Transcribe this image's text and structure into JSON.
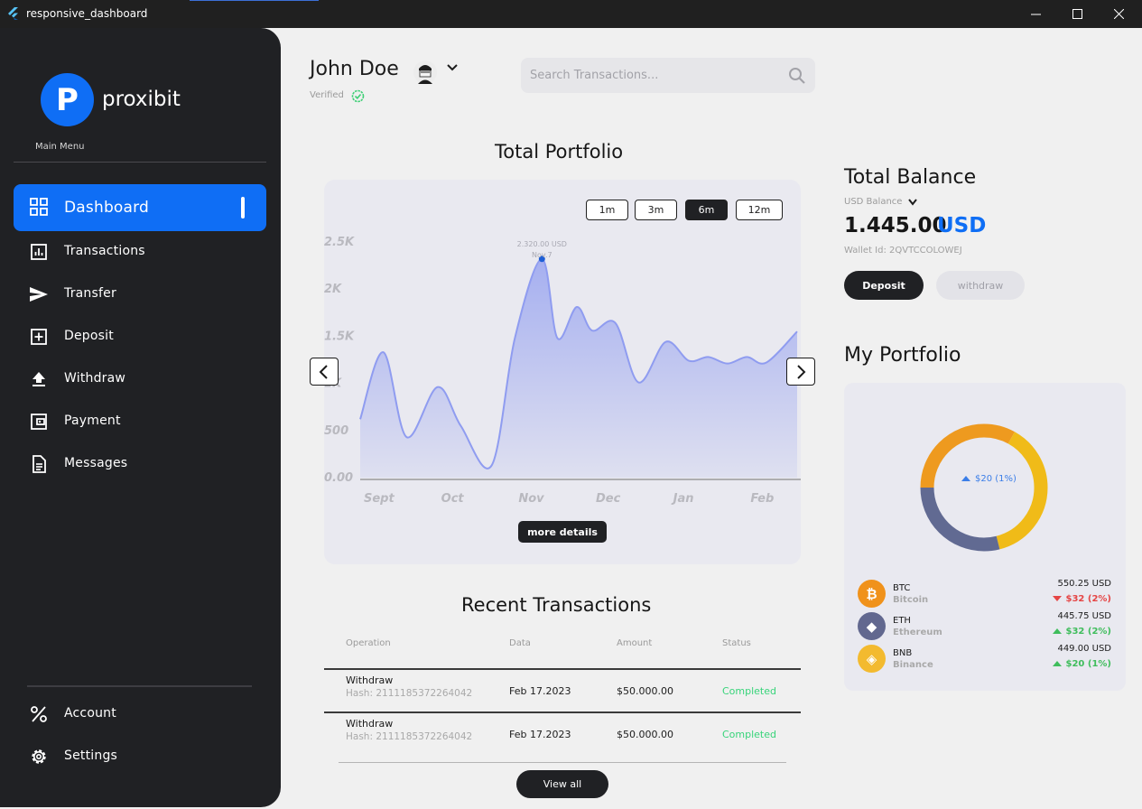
{
  "window": {
    "title": "responsive_dashboard"
  },
  "brand": {
    "letter": "P",
    "name": "proxibit",
    "accent": "#0f6ef5"
  },
  "sidebar": {
    "section_label": "Main Menu",
    "items": [
      {
        "label": "Dashboard",
        "icon": "grid-icon",
        "active": true
      },
      {
        "label": "Transactions",
        "icon": "bar-chart-icon"
      },
      {
        "label": "Transfer",
        "icon": "send-icon"
      },
      {
        "label": "Deposit",
        "icon": "plus-square-icon"
      },
      {
        "label": "Withdraw",
        "icon": "upload-icon"
      },
      {
        "label": "Payment",
        "icon": "wallet-icon"
      },
      {
        "label": "Messages",
        "icon": "document-icon"
      }
    ],
    "bottom_items": [
      {
        "label": "Account",
        "icon": "percent-icon"
      },
      {
        "label": "Settings",
        "icon": "gear-icon"
      }
    ]
  },
  "header": {
    "user_name": "John Doe",
    "verified_label": "Verified",
    "search_placeholder": "Search Transactions..."
  },
  "portfolio_chart": {
    "title": "Total Portfolio",
    "ranges": [
      "1m",
      "3m",
      "6m",
      "12m"
    ],
    "selected_range": "6m",
    "more_details_label": "more details",
    "tooltip_value": "2.320.00 USD",
    "tooltip_date": "Nov.7"
  },
  "chart_data": {
    "type": "area",
    "title": "Total Portfolio",
    "categories": [
      "Sept",
      "Oct",
      "Nov",
      "Dec",
      "Jan",
      "Feb"
    ],
    "y_tick_labels": [
      "0.00",
      "500",
      "1K",
      "1.5K",
      "2K",
      "2.5K"
    ],
    "ylim": [
      0,
      2500
    ],
    "x": [
      0,
      0.3,
      0.6,
      1.0,
      1.3,
      1.7,
      2.0,
      2.35,
      2.55,
      2.8,
      3.0,
      3.3,
      3.6,
      3.95,
      4.25,
      4.5,
      4.75,
      5.0,
      5.25,
      5.65
    ],
    "series": [
      {
        "values": [
          620,
          1330,
          430,
          960,
          550,
          130,
          1480,
          2320,
          1480,
          1810,
          1560,
          1640,
          1010,
          1440,
          1240,
          1280,
          1210,
          1280,
          1220,
          1550
        ]
      }
    ],
    "highlight_point": {
      "x": 2.35,
      "y": 2320,
      "label": "2.320.00 USD",
      "date": "Nov.7"
    },
    "grid": false,
    "color": "#8f9cf0"
  },
  "transactions": {
    "title": "Recent Transactions",
    "columns": [
      "Operation",
      "Data",
      "Amount",
      "Status"
    ],
    "rows": [
      {
        "operation": "Withdraw",
        "hash": "Hash: 2111185372264042",
        "date": "Feb 17.2023",
        "amount": "$50.000.00",
        "status": "Completed"
      },
      {
        "operation": "Withdraw",
        "hash": "Hash: 2111185372264042",
        "date": "Feb 17.2023",
        "amount": "$50.000.00",
        "status": "Completed"
      }
    ],
    "view_all_label": "View all"
  },
  "balance": {
    "title": "Total Balance",
    "selector_label": "USD Balance",
    "amount": "1.445.00",
    "currency": "USD",
    "wallet_id": "Wallet Id: 2QVTCCOLOWEJ",
    "deposit_label": "Deposit",
    "withdraw_label": "withdraw"
  },
  "my_portfolio": {
    "title": "My Portfolio",
    "center_label": "$20 (1%)",
    "donut_segments": [
      {
        "name": "BTC",
        "share": 0.33,
        "color": "#ee9a1f"
      },
      {
        "name": "BNB",
        "share": 0.38,
        "color": "#f0bb18"
      },
      {
        "name": "ETH",
        "share": 0.29,
        "color": "#616a92"
      }
    ],
    "coins": [
      {
        "symbol": "BTC",
        "name": "Bitcoin",
        "value": "550.25 USD",
        "change": "$32 (2%)",
        "direction": "down",
        "color": "#f0921b",
        "icon": "bitcoin-icon",
        "glyph": "₿"
      },
      {
        "symbol": "ETH",
        "name": "Ethereum",
        "value": "445.75 USD",
        "change": "$32 (2%)",
        "direction": "up",
        "color": "#62688f",
        "icon": "ethereum-icon",
        "glyph": "◆"
      },
      {
        "symbol": "BNB",
        "name": "Binance",
        "value": "449.00 USD",
        "change": "$20 (1%)",
        "direction": "up",
        "color": "#f3ba2f",
        "icon": "binance-icon",
        "glyph": "◈"
      }
    ]
  }
}
